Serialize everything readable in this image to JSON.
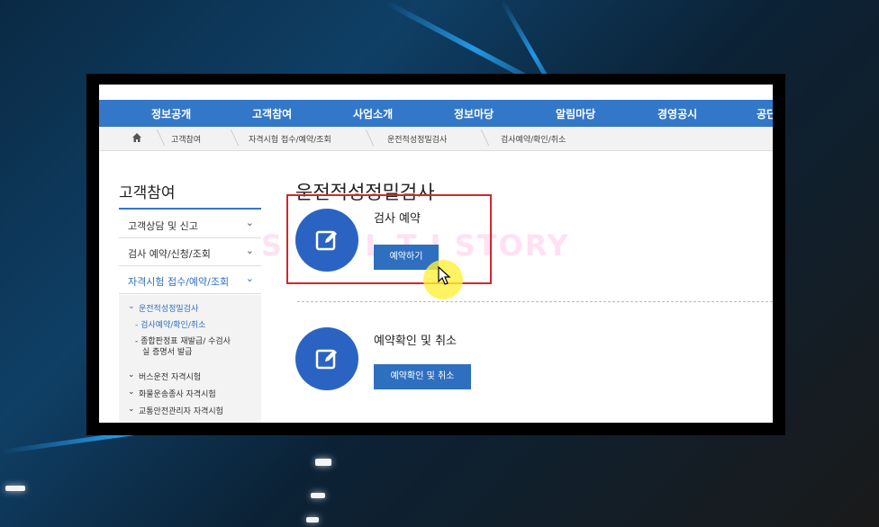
{
  "watermark": "S T A L T I STORY",
  "gnb": [
    "정보공개",
    "고객참여",
    "사업소개",
    "정보마당",
    "알림마당",
    "경영공시",
    "공단"
  ],
  "breadcrumb": [
    "고객참여",
    "자격시험 접수/예약/조회",
    "운전적성정밀검사",
    "검사예약/확인/취소"
  ],
  "sidebar": {
    "title": "고객참여",
    "items": [
      "고객상담 및 신고",
      "검사 예약/신청/조회",
      "자격시험 접수/예약/조회"
    ],
    "sub_active": "운전적성정밀검사",
    "sub_items": [
      "- 검사예약/확인/취소",
      "- 종합판정표 재발급/ 수검사",
      "실 증명서 발급"
    ],
    "more_items": [
      "버스운전 자격시험",
      "화물운송종사 자격시험",
      "교통안전관리자 자격시험"
    ]
  },
  "main": {
    "page_title": "운전적성정밀검사",
    "section1": {
      "title": "검사 예약",
      "button": "예약하기"
    },
    "section2": {
      "title": "예약확인 및 취소",
      "button": "예약확인 및 취소"
    }
  },
  "colors": {
    "accent": "#3377c8",
    "highlight_box": "#d0282c",
    "icon_circle": "#2b63c2"
  }
}
